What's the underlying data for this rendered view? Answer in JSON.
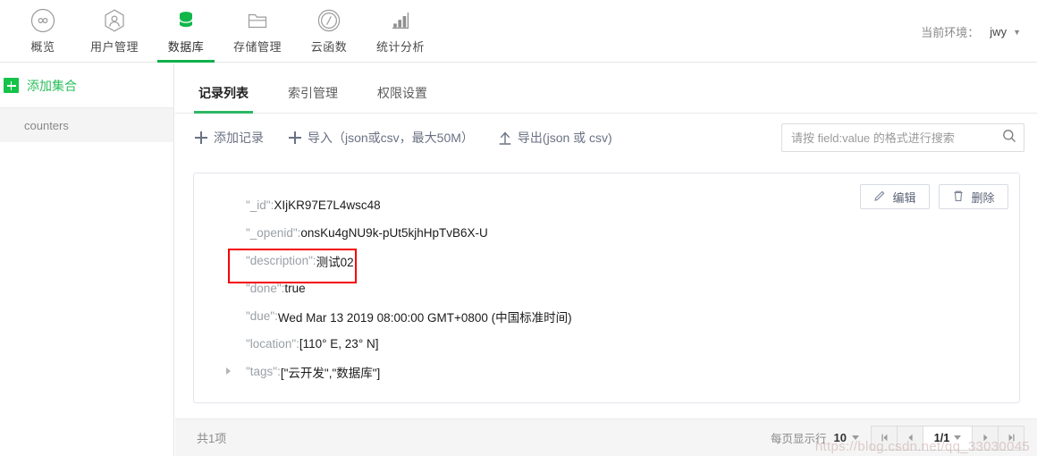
{
  "topnav": {
    "items": [
      {
        "label": "概览",
        "icon": "infinity-icon",
        "active": false
      },
      {
        "label": "用户管理",
        "icon": "user-hexagon-icon",
        "active": false
      },
      {
        "label": "数据库",
        "icon": "database-icon",
        "active": true
      },
      {
        "label": "存储管理",
        "icon": "folder-icon",
        "active": false
      },
      {
        "label": "云函数",
        "icon": "function-circle-icon",
        "active": false
      },
      {
        "label": "统计分析",
        "icon": "bar-chart-icon",
        "active": false
      }
    ],
    "env_label": "当前环境：",
    "env_value": "jwy",
    "env_caret": "▼"
  },
  "sidebar": {
    "add_collection_label": "添加集合",
    "collections": [
      {
        "name": "counters",
        "selected": true
      }
    ]
  },
  "tabs": [
    {
      "label": "记录列表",
      "active": true
    },
    {
      "label": "索引管理",
      "active": false
    },
    {
      "label": "权限设置",
      "active": false
    }
  ],
  "toolbar": {
    "add_record_label": "添加记录",
    "import_label": "导入（json或csv，最大50M）",
    "export_label": "导出(json 或 csv)"
  },
  "search": {
    "placeholder": "请按 field:value 的格式进行搜索",
    "value": "",
    "icon": "search-icon"
  },
  "record": {
    "edit_label": "编辑",
    "delete_label": "删除",
    "fields": [
      {
        "key": "\"_id\":",
        "value": "XIjKR97E7L4wsc48",
        "expandable": false
      },
      {
        "key": "\"_openid\":",
        "value": "onsKu4gNU9k-pUt5kjhHpTvB6X-U",
        "expandable": false
      },
      {
        "key": "\"description\":",
        "value": "测试02",
        "expandable": false
      },
      {
        "key": "\"done\":",
        "value": "true",
        "expandable": false
      },
      {
        "key": "\"due\":",
        "value": "Wed Mar 13 2019 08:00:00 GMT+0800 (中国标准时间)",
        "expandable": false
      },
      {
        "key": "\"location\":",
        "value": "[110° E, 23° N]",
        "expandable": false
      },
      {
        "key": "\"tags\":",
        "value": "[\"云开发\",\"数据库\"]",
        "expandable": true
      }
    ],
    "annotation_color": "#f40000"
  },
  "footer": {
    "total_label": "共1项",
    "page_size_label": "每页显示行",
    "page_size_value": "10",
    "page_indicator": "1/1",
    "first_icon": "first-page-icon",
    "prev_icon": "prev-page-icon",
    "next_icon": "next-page-icon",
    "last_icon": "last-page-icon",
    "watermark": "https://blog.csdn.net/qq_33030045"
  },
  "colors": {
    "accent_green": "#0faf4a",
    "tab_green": "#2eb866",
    "add_green": "#2bbf5c",
    "annotation_red": "#f40000"
  }
}
